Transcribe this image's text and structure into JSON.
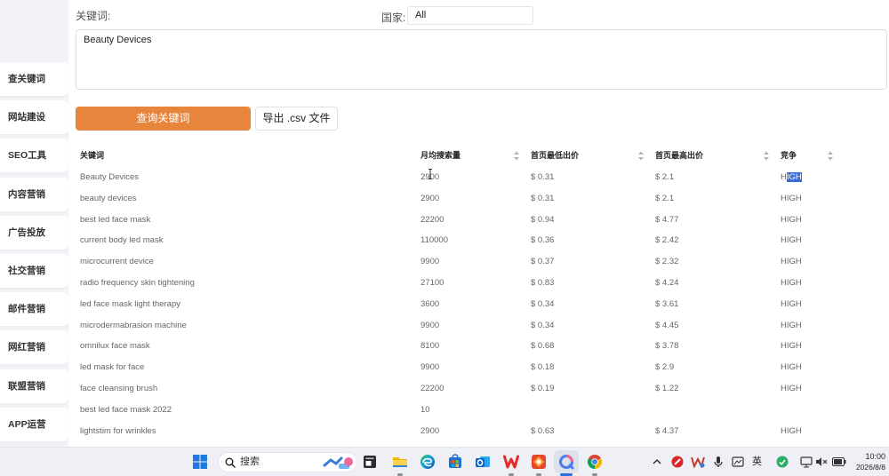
{
  "sidebar": {
    "items": [
      "查关键词",
      "网站建设",
      "SEO工具",
      "内容营销",
      "广告投放",
      "社交营销",
      "邮件营销",
      "网红营销",
      "联盟营销",
      "APP运营"
    ]
  },
  "form": {
    "keyword_label": "关键词:",
    "country_label": "国家:",
    "country_value": "All",
    "keywords_input": "Beauty Devices",
    "query_button": "查询关键词",
    "export_button": "导出 .csv 文件"
  },
  "table": {
    "columns": {
      "keyword": "关键词",
      "volume": "月均搜索量",
      "low_bid": "首页最低出价",
      "high_bid": "首页最高出价",
      "competition": "竞争"
    },
    "rows": [
      {
        "keyword": "Beauty Devices",
        "volume": "2900",
        "low_bid": "$ 0.31",
        "high_bid": "$ 2.1",
        "competition": "HIGH"
      },
      {
        "keyword": "beauty devices",
        "volume": "2900",
        "low_bid": "$ 0.31",
        "high_bid": "$ 2.1",
        "competition": "HIGH"
      },
      {
        "keyword": "best led face mask",
        "volume": "22200",
        "low_bid": "$ 0.94",
        "high_bid": "$ 4.77",
        "competition": "HIGH"
      },
      {
        "keyword": "current body led mask",
        "volume": "110000",
        "low_bid": "$ 0.36",
        "high_bid": "$ 2.42",
        "competition": "HIGH"
      },
      {
        "keyword": "microcurrent device",
        "volume": "9900",
        "low_bid": "$ 0.37",
        "high_bid": "$ 2.32",
        "competition": "HIGH"
      },
      {
        "keyword": "radio frequency skin tightening",
        "volume": "27100",
        "low_bid": "$ 0.83",
        "high_bid": "$ 4.24",
        "competition": "HIGH"
      },
      {
        "keyword": "led face mask light therapy",
        "volume": "3600",
        "low_bid": "$ 0.34",
        "high_bid": "$ 3.61",
        "competition": "HIGH"
      },
      {
        "keyword": "microdermabrasion machine",
        "volume": "9900",
        "low_bid": "$ 0.34",
        "high_bid": "$ 4.45",
        "competition": "HIGH"
      },
      {
        "keyword": "omnilux face mask",
        "volume": "8100",
        "low_bid": "$ 0.68",
        "high_bid": "$ 3.78",
        "competition": "HIGH"
      },
      {
        "keyword": "led mask for face",
        "volume": "9900",
        "low_bid": "$ 0.18",
        "high_bid": "$ 2.9",
        "competition": "HIGH"
      },
      {
        "keyword": "face cleansing brush",
        "volume": "22200",
        "low_bid": "$ 0.19",
        "high_bid": "$ 1.22",
        "competition": "HIGH"
      },
      {
        "keyword": "best led face mask 2022",
        "volume": "10",
        "low_bid": "",
        "high_bid": "",
        "competition": ""
      },
      {
        "keyword": "lightstim for wrinkles",
        "volume": "2900",
        "low_bid": "$ 0.63",
        "high_bid": "$ 4.37",
        "competition": "HIGH"
      }
    ],
    "selection": {
      "row": 0,
      "column": 4,
      "start_char": 1
    }
  },
  "taskbar": {
    "search_label": "搜索",
    "app_icons": [
      "windows-start-icon",
      "task-view-icon",
      "file-explorer-icon",
      "edge-icon",
      "microsoft-store-icon",
      "outlook-icon",
      "wps-office-icon",
      "red-app-icon",
      "browser-app-icon",
      "chrome-icon"
    ],
    "tray_icons": [
      "chevron-up-icon",
      "red-circle-tray-icon",
      "wps-cloud-tray-icon",
      "microphone-icon",
      "screenshot-tray-icon",
      "green-tray-icon",
      "network-icon",
      "volume-muted-icon",
      "battery-icon"
    ],
    "tray": {
      "ime_label": "英",
      "time": "10:00",
      "date": "2026/8/8"
    }
  },
  "colors": {
    "accent": "#e8853d",
    "selection": "#3a6bd6",
    "text_muted": "#666666"
  }
}
